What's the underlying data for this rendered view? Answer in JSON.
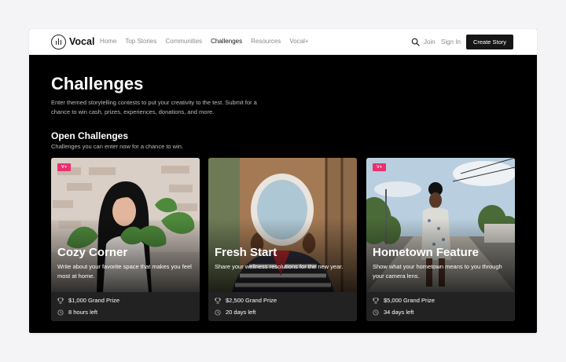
{
  "nav": {
    "brand": "Vocal",
    "items": [
      "Home",
      "Top Stories",
      "Communities",
      "Challenges",
      "Resources",
      "Vocal+"
    ],
    "active_index": 3,
    "join": "Join",
    "sign_in": "Sign In",
    "create_story": "Create Story",
    "icons": {
      "logo": "vocal-logo-icon",
      "search": "search-icon"
    }
  },
  "page": {
    "title": "Challenges",
    "description": "Enter themed storytelling contests to put your creativity to the test. Submit for a chance to win cash, prizes, experiences, donations, and more.",
    "section_title": "Open Challenges",
    "section_subtitle": "Challenges you can enter now for a chance to win."
  },
  "cards": [
    {
      "badge": "V+",
      "title": "Cozy Corner",
      "description": "Write about your favorite space that makes you feel most at home.",
      "prize": "$1,000 Grand Prize",
      "time_left": "8 hours left"
    },
    {
      "badge": "",
      "title": "Fresh Start",
      "description": "Share your wellness resolutions for the new year.",
      "prize": "$2,500 Grand Prize",
      "time_left": "20 days left"
    },
    {
      "badge": "V+",
      "title": "Hometown Feature",
      "description": "Show what your hometown means to you through your camera lens.",
      "prize": "$5,000 Grand Prize",
      "time_left": "34 days left"
    }
  ],
  "colors": {
    "badge": "#ec2f6f",
    "background": "#000000",
    "nav": "#ffffff"
  }
}
